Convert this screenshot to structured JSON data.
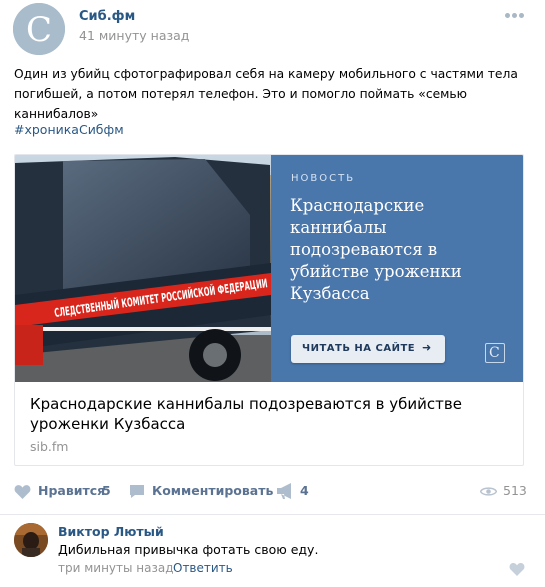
{
  "post": {
    "author": "Сиб.фм",
    "time": "41 минуту назад",
    "text": "Один из убийц сфотографировал себя на камеру мобильного с частями тела погибшей, а потом потерял телефон. Это и помогло поймать «семью каннибалов»",
    "hashtag": "#хроникаСибфм",
    "avatar_letter": "C"
  },
  "card": {
    "kicker": "НОВОСТЬ",
    "promo_title": "Краснодарские каннибалы подозреваются в убийстве уроженки Кузбасса",
    "button_label": "ЧИТАТЬ НА САЙТЕ",
    "button_arrow": "➜",
    "logo_letter": "C",
    "photo_text": "СЛЕДСТВЕННЫЙ КОМИТЕТ РОССИЙСКОЙ ФЕДЕРАЦИИ",
    "caption": "Краснодарские каннибалы подозреваются в убийстве уроженки Кузбасса",
    "domain": "sib.fm"
  },
  "actions": {
    "like_label": "Нравится",
    "like_count": "5",
    "comment_label": "Комментировать",
    "share_count": "4",
    "views_count": "513"
  },
  "comment": {
    "author": "Виктор Лютый",
    "text": "Дибильная привычка фотать свою еду.",
    "time": "три минуты назад",
    "reply_label": "Ответить"
  },
  "colors": {
    "link": "#2a5885",
    "meta": "#939393",
    "action": "#5b7392",
    "promo_bg": "#4976ab"
  },
  "icons": [
    "more-icon",
    "heart-icon",
    "comment-icon",
    "share-icon",
    "eye-icon",
    "like-icon"
  ]
}
